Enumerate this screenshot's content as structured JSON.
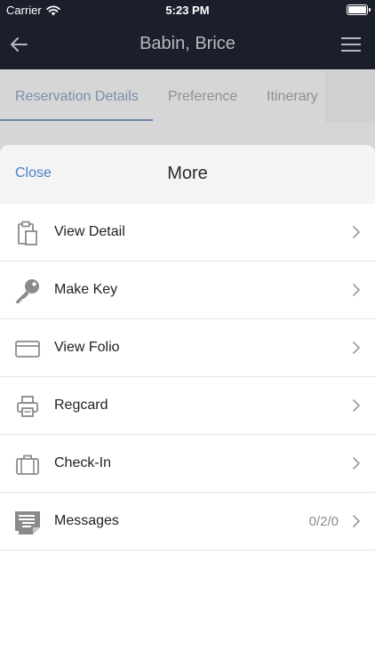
{
  "status_bar": {
    "carrier": "Carrier",
    "time": "5:23 PM"
  },
  "nav": {
    "title": "Babin, Brice"
  },
  "tabs": [
    {
      "label": "Reservation Details",
      "active": true
    },
    {
      "label": "Preference",
      "active": false
    },
    {
      "label": "Itinerary",
      "active": false
    }
  ],
  "sheet": {
    "close_label": "Close",
    "title": "More",
    "items": [
      {
        "label": "View Detail",
        "icon": "clipboard-icon",
        "value": ""
      },
      {
        "label": "Make Key",
        "icon": "key-icon",
        "value": ""
      },
      {
        "label": "View Folio",
        "icon": "credit-card-icon",
        "value": ""
      },
      {
        "label": "Regcard",
        "icon": "printer-icon",
        "value": ""
      },
      {
        "label": "Check-In",
        "icon": "suitcase-icon",
        "value": ""
      },
      {
        "label": "Messages",
        "icon": "message-icon",
        "value": "0/2/0"
      }
    ]
  },
  "colors": {
    "nav_background": "#1a1f2b",
    "link_blue": "#4a7fc8",
    "tab_active_underline": "#6e85aa"
  }
}
